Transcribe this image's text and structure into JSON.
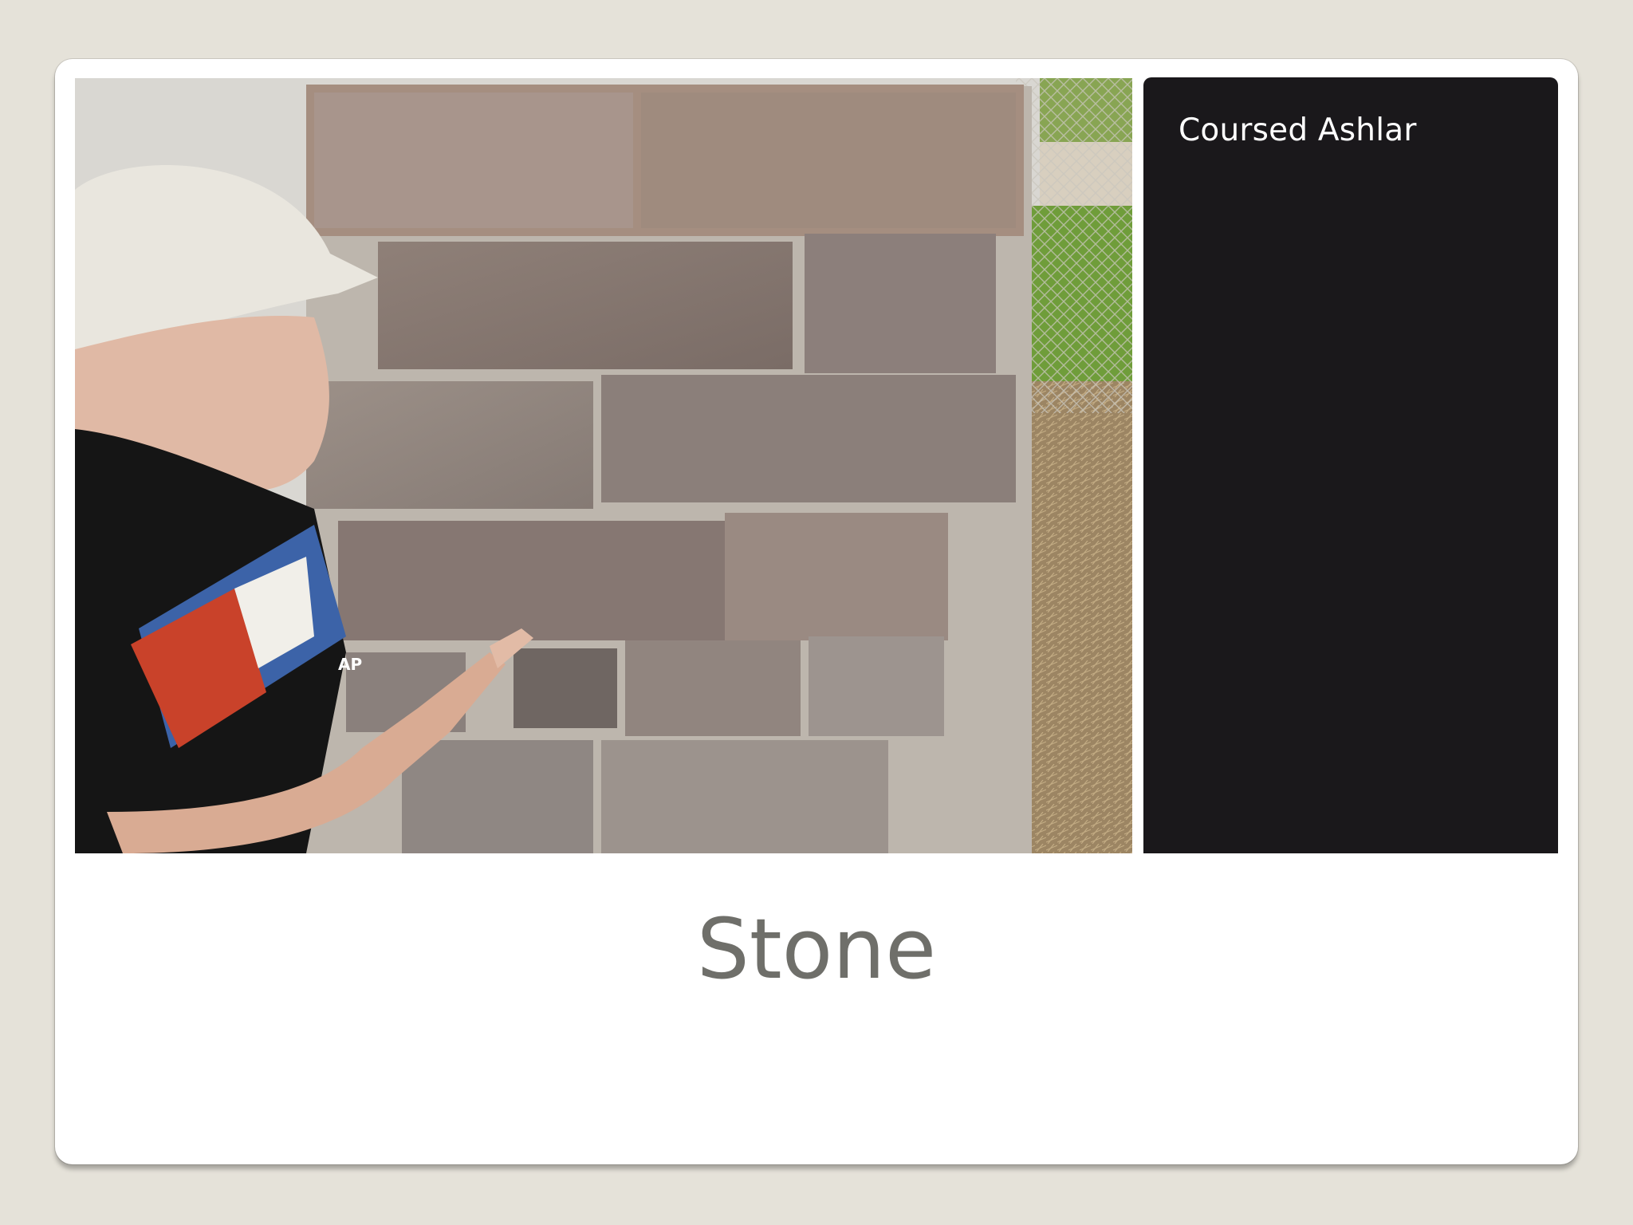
{
  "slide": {
    "title": "Stone",
    "caption": "Coursed Ashlar",
    "photo": {
      "subject": "stone-pillar-coursed-ashlar",
      "shirt_text": "AP"
    },
    "colors": {
      "background": "#e5e2d9",
      "card": "#ffffff",
      "caption_panel": "#1a181b",
      "caption_text": "#ffffff",
      "title_text": "#6f6f6a"
    }
  }
}
